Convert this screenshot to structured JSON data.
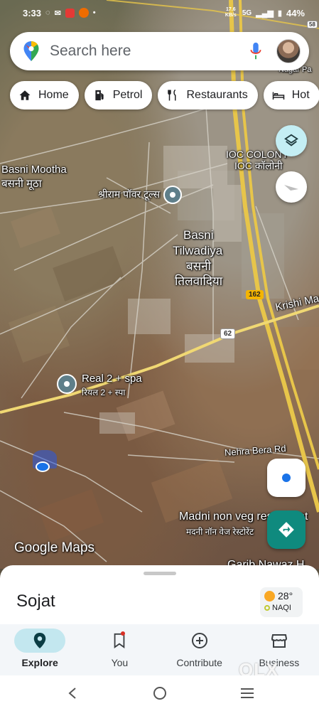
{
  "status_bar": {
    "time": "3:33",
    "network_speed": "17.6 KB/s",
    "network_type": "5G",
    "battery": "44%"
  },
  "search": {
    "placeholder": "Search here"
  },
  "chips": [
    {
      "label": "Home",
      "icon": "home-icon"
    },
    {
      "label": "Petrol",
      "icon": "fuel-icon"
    },
    {
      "label": "Restaurants",
      "icon": "fork-knife-icon"
    },
    {
      "label": "Hot",
      "icon": "bed-icon"
    }
  ],
  "map": {
    "labels": {
      "basni_mootha_en": "Basni Mootha",
      "basni_mootha_hi": "बसनी मूठा",
      "shriram_power": "श्रीराम पॉवर टूल्स",
      "ioc_colony_en": "IOC COLONY",
      "ioc_colony_hi": "IOC कॉलोनी",
      "basni_tilwadiya_en_1": "Basni",
      "basni_tilwadiya_en_2": "Tilwadiya",
      "basni_tilwadiya_hi_1": "बसनी",
      "basni_tilwadiya_hi_2": "तिलवादिया",
      "krishi_mandi": "Krishi Mand",
      "real_spa_en": "Real 2 + spa",
      "real_spa_hi": "रियल 2 + स्पा",
      "nehra_bera_rd": "Nehra Bera Rd",
      "madni_en": "Madni non veg restaurant",
      "madni_hi": "मदनी नॉन वेज रेस्टोरेंट",
      "garib_nawaz": "Garib Nawaz H",
      "nagar": "Nagar Pa"
    },
    "road_shields": {
      "s58": "58",
      "nh162": "162",
      "nh62": "62"
    },
    "logo": "Google Maps"
  },
  "sheet": {
    "place_name": "Sojat",
    "temperature": "28°",
    "aqi_label": "NAQI"
  },
  "bottom_nav": [
    {
      "label": "Explore",
      "icon": "location-pin-icon",
      "active": true
    },
    {
      "label": "You",
      "icon": "bookmark-icon",
      "active": false
    },
    {
      "label": "Contribute",
      "icon": "add-circle-icon",
      "active": false
    },
    {
      "label": "Business",
      "icon": "storefront-icon",
      "active": false
    }
  ],
  "watermark": "OLX",
  "colors": {
    "accent_teal": "#0f8a7e",
    "active_nav_bg": "#c3e7ef",
    "road_yellow": "#f4b400"
  }
}
